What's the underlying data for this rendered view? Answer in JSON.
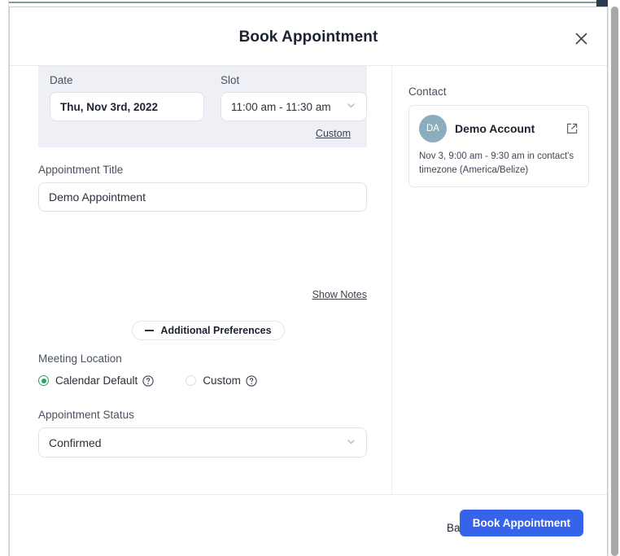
{
  "header": {
    "title": "Book Appointment",
    "close_icon": "close-icon"
  },
  "dateslot": {
    "date_label": "Date",
    "date_value": "Thu, Nov 3rd, 2022",
    "slot_label": "Slot",
    "slot_value": "11:00 am - 11:30 am",
    "slot_chevron_icon": "chevron-down-icon",
    "custom_link": "Custom"
  },
  "title_field": {
    "label": "Appointment Title",
    "value": "Demo Appointment"
  },
  "show_notes_link": "Show Notes",
  "preferences": {
    "toggle_label": "Additional Preferences",
    "toggle_icon": "minus-icon"
  },
  "meeting_location": {
    "label": "Meeting Location",
    "options": [
      {
        "label": "Calendar Default",
        "selected": true,
        "help_icon": "help-circle-icon"
      },
      {
        "label": "Custom",
        "selected": false,
        "help_icon": "help-circle-icon"
      }
    ]
  },
  "status_field": {
    "label": "Appointment Status",
    "value": "Confirmed",
    "chevron_icon": "chevron-down-icon"
  },
  "contact": {
    "heading": "Contact",
    "avatar_initials": "DA",
    "name": "Demo Account",
    "external_link_icon": "external-link-icon",
    "details": "Nov 3, 9:00 am - 9:30 am in contact's timezone (America/Belize)"
  },
  "footer": {
    "back_label": "Back",
    "primary_label": "Book Appointment"
  },
  "colors": {
    "primary": "#3563e9",
    "radio_selected": "#27a567",
    "avatar": "#8badbd",
    "panel_bg": "#eef0f5"
  }
}
